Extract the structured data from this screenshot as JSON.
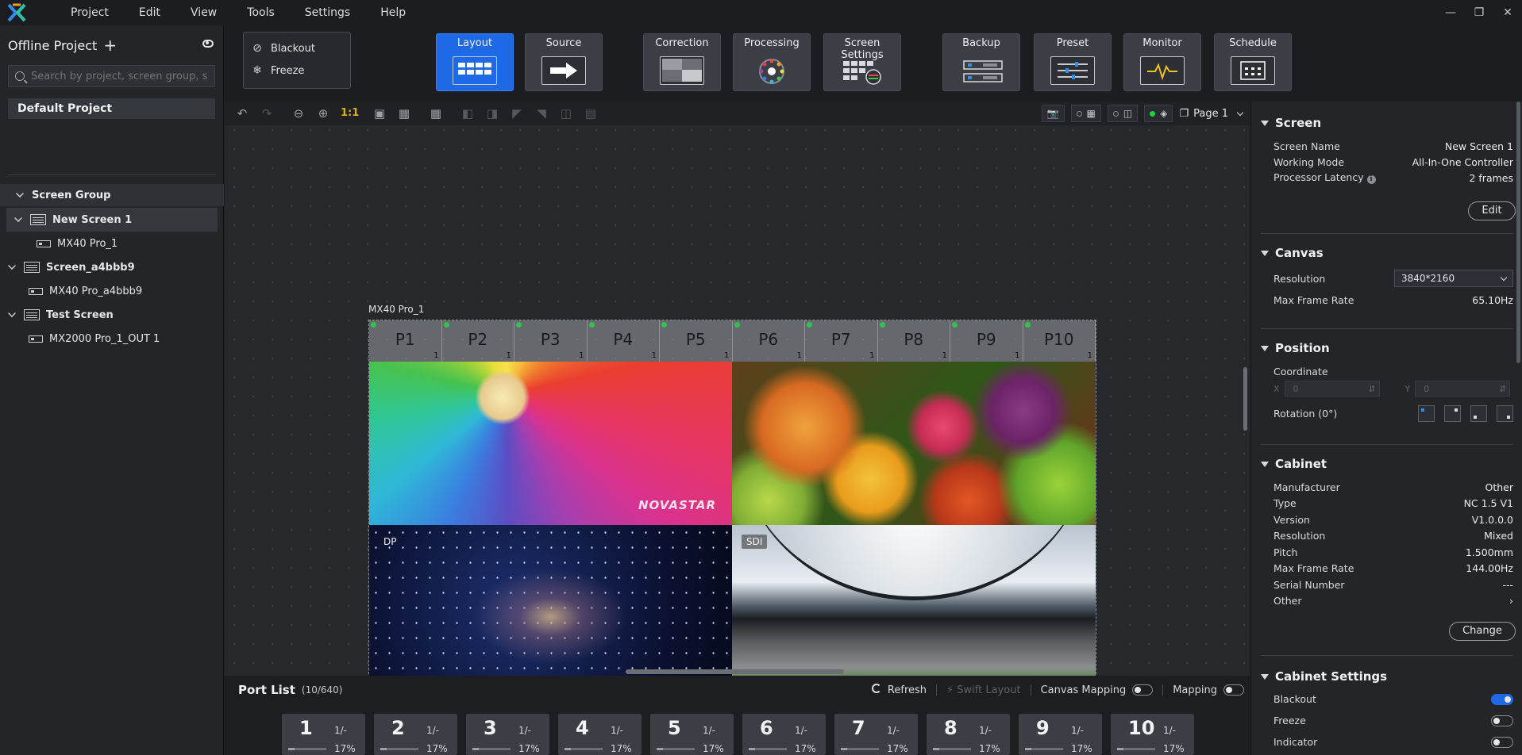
{
  "menu": [
    "Project",
    "Edit",
    "View",
    "Tools",
    "Settings",
    "Help"
  ],
  "colors": {
    "accent": "#1e6ae6",
    "online": "#1fd43a",
    "background": "#1d1f23"
  },
  "left": {
    "project_title": "Offline Project",
    "search_placeholder": "Search by project, screen group, sc...",
    "default_project": "Default Project",
    "screen_group_label": "Screen Group",
    "tree": [
      {
        "label": "New Screen 1",
        "child": "MX40 Pro_1"
      },
      {
        "label": "Screen_a4bbb9",
        "child": "MX40 Pro_a4bbb9"
      },
      {
        "label": "Test Screen",
        "child": "MX2000 Pro_1_OUT 1"
      }
    ]
  },
  "toolbar": {
    "blackout": "Blackout",
    "freeze": "Freeze",
    "buttons": [
      "Layout",
      "Source",
      "Correction",
      "Processing",
      "Screen Settings",
      "Backup",
      "Preset",
      "Monitor",
      "Schedule"
    ]
  },
  "canvas": {
    "zoom_label": "1:1",
    "page": "Page 1",
    "device_label": "MX40 Pro_1",
    "ports": [
      "P1",
      "P2",
      "P3",
      "P4",
      "P5",
      "P6",
      "P7",
      "P8",
      "P9",
      "P10"
    ],
    "port_index": "1",
    "watermark": "NOVASTAR",
    "tag_dp": "DP",
    "tag_sdi": "SDI"
  },
  "portlist": {
    "title": "Port List",
    "count": "(10/640)",
    "refresh": "Refresh",
    "swift_layout": "Swift Layout",
    "canvas_mapping": "Canvas Mapping",
    "mapping": "Mapping",
    "cards": [
      {
        "num": "1",
        "frac": "1/-",
        "pct": "17%",
        "fill": 0.17
      },
      {
        "num": "2",
        "frac": "1/-",
        "pct": "17%",
        "fill": 0.17
      },
      {
        "num": "3",
        "frac": "1/-",
        "pct": "17%",
        "fill": 0.17
      },
      {
        "num": "4",
        "frac": "1/-",
        "pct": "17%",
        "fill": 0.17
      },
      {
        "num": "5",
        "frac": "1/-",
        "pct": "17%",
        "fill": 0.17
      },
      {
        "num": "6",
        "frac": "1/-",
        "pct": "17%",
        "fill": 0.17
      },
      {
        "num": "7",
        "frac": "1/-",
        "pct": "17%",
        "fill": 0.17
      },
      {
        "num": "8",
        "frac": "1/-",
        "pct": "17%",
        "fill": 0.17
      },
      {
        "num": "9",
        "frac": "1/-",
        "pct": "17%",
        "fill": 0.17
      },
      {
        "num": "10",
        "frac": "1/-",
        "pct": "17%",
        "fill": 0.17
      }
    ]
  },
  "right": {
    "screen": {
      "title": "Screen",
      "name_label": "Screen Name",
      "name": "New Screen 1",
      "mode_label": "Working Mode",
      "mode": "All-In-One Controller",
      "latency_label": "Processor Latency",
      "latency": "2 frames",
      "edit": "Edit"
    },
    "canvas": {
      "title": "Canvas",
      "res_label": "Resolution",
      "res": "3840*2160",
      "rate_label": "Max Frame Rate",
      "rate": "65.10Hz"
    },
    "position": {
      "title": "Position",
      "coord_label": "Coordinate",
      "x_label": "X",
      "x": "0",
      "y_label": "Y",
      "y": "0",
      "rotation_label": "Rotation (0°)"
    },
    "cabinet": {
      "title": "Cabinet",
      "rows": [
        {
          "k": "Manufacturer",
          "v": "Other"
        },
        {
          "k": "Type",
          "v": "NC 1.5 V1"
        },
        {
          "k": "Version",
          "v": "V1.0.0.0"
        },
        {
          "k": "Resolution",
          "v": "Mixed"
        },
        {
          "k": "Pitch",
          "v": "1.500mm"
        },
        {
          "k": "Max Frame Rate",
          "v": "144.00Hz"
        },
        {
          "k": "Serial Number",
          "v": "---"
        },
        {
          "k": "Other",
          "v": "›"
        }
      ],
      "change": "Change"
    },
    "cabinet_settings": {
      "title": "Cabinet Settings",
      "blackout": "Blackout",
      "freeze": "Freeze",
      "indicator": "Indicator"
    }
  }
}
